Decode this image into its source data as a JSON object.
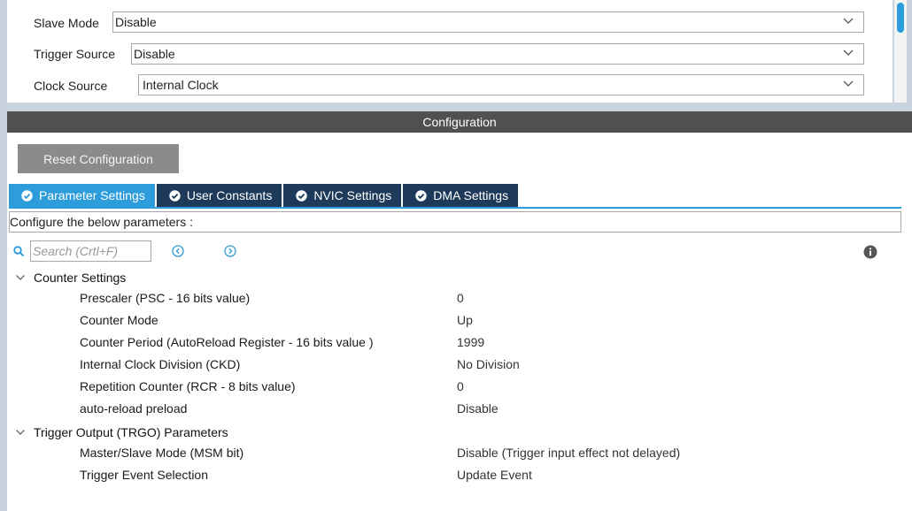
{
  "mode": {
    "slave_mode": {
      "label": "Slave Mode",
      "value": "Disable"
    },
    "trigger_source": {
      "label": "Trigger Source",
      "value": "Disable"
    },
    "clock_source": {
      "label": "Clock Source",
      "value": "Internal Clock"
    }
  },
  "config": {
    "header": "Configuration",
    "reset_label": "Reset Configuration",
    "tabs": [
      {
        "label": "Parameter Settings",
        "active": true
      },
      {
        "label": "User Constants",
        "active": false
      },
      {
        "label": "NVIC Settings",
        "active": false
      },
      {
        "label": "DMA Settings",
        "active": false
      }
    ],
    "description": "Configure the below parameters :",
    "search_placeholder": "Search (Crtl+F)",
    "groups": [
      {
        "label": "Counter Settings",
        "params": [
          {
            "name": "Prescaler (PSC - 16 bits value)",
            "value": "0"
          },
          {
            "name": "Counter Mode",
            "value": "Up"
          },
          {
            "name": "Counter Period (AutoReload Register - 16 bits value )",
            "value": "1999"
          },
          {
            "name": "Internal Clock Division (CKD)",
            "value": "No Division"
          },
          {
            "name": "Repetition Counter (RCR - 8 bits value)",
            "value": "0"
          },
          {
            "name": "auto-reload preload",
            "value": "Disable"
          }
        ]
      },
      {
        "label": "Trigger Output (TRGO) Parameters",
        "params": [
          {
            "name": "Master/Slave Mode (MSM bit)",
            "value": "Disable (Trigger input effect not delayed)"
          },
          {
            "name": "Trigger Event Selection",
            "value": "Update Event"
          }
        ]
      }
    ]
  },
  "colors": {
    "accent": "#2d9cdb",
    "tab_inactive": "#1e3a5a",
    "header_bar": "#505050",
    "button": "#8b8b8b"
  }
}
